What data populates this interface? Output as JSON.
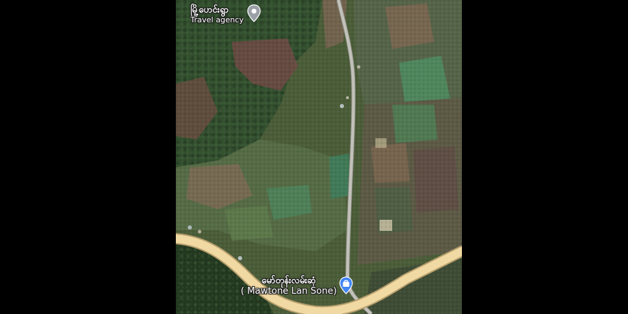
{
  "map": {
    "view": "satellite",
    "land_colors": {
      "forest": "#2f4a2a",
      "farmland_red": "#6b4a3f",
      "field_green": "#4f7a52",
      "field_brown": "#7a6a52",
      "road_major": "#f1d9a3",
      "road_minor": "#b8b8b0"
    }
  },
  "places": [
    {
      "name": "မြို့ပောင်းရွာ",
      "category": "Travel agency",
      "icon": "pin-gray-icon",
      "pin_color": "#9aa0a6"
    },
    {
      "name": "မော်တုန်းလမ်းဆုံ",
      "subtitle": "( Mawtone Lan Sone)",
      "icon": "shopping-bag-pin-icon",
      "pin_color": "#4285f4"
    }
  ]
}
